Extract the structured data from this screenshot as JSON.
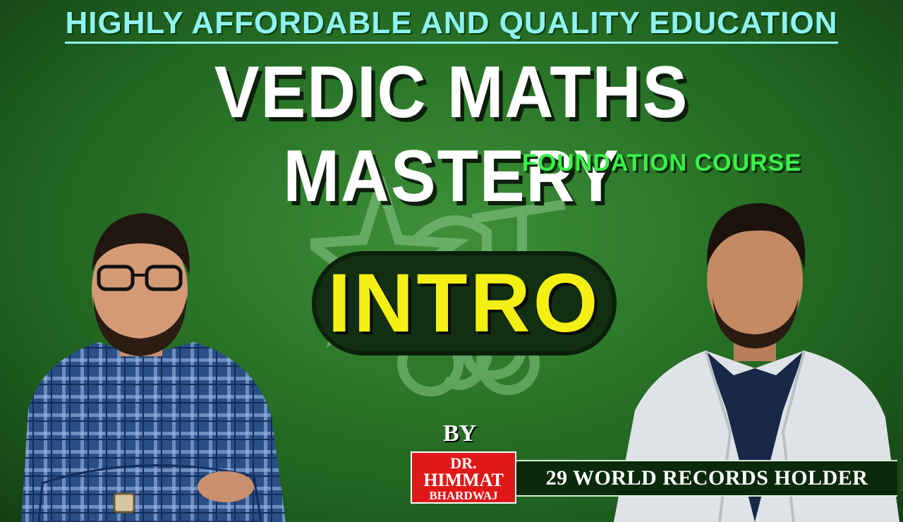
{
  "banner": {
    "tagline": "HIGHLY AFFORDABLE AND QUALITY EDUCATION",
    "title": "VEDIC MATHS MASTERY",
    "subtitle": "FOUNDATION COURSE",
    "badge_text": "INTRO"
  },
  "presenter": {
    "by_label": "BY",
    "name_line1": "DR.",
    "name_line2": "HIMMAT",
    "name_line3": "BHARDWAJ",
    "records_text": "29 WORLD RECORDS HOLDER"
  },
  "colors": {
    "background": "#2c7a2a",
    "tagline": "#8ff2f0",
    "subtitle": "#3cf04a",
    "intro_text": "#f4f013",
    "badge_red": "#e01818"
  },
  "icons": [
    "vedic-logo-watermark",
    "person-left-portrait",
    "person-right-portrait"
  ]
}
